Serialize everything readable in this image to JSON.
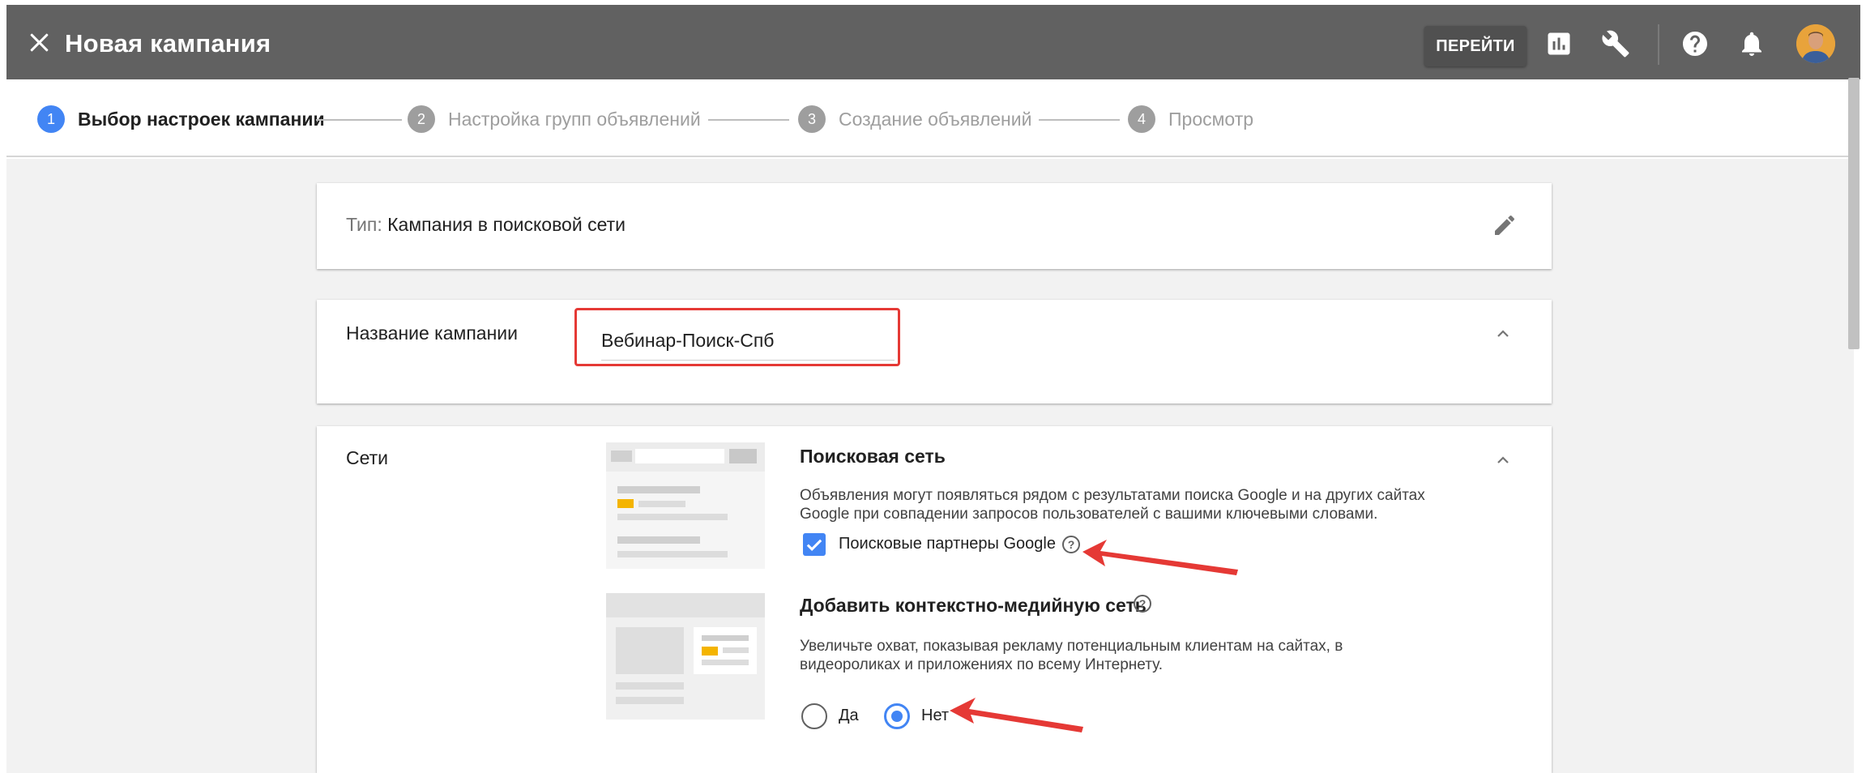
{
  "header": {
    "title": "Новая кампания",
    "goto_label": "ПЕРЕЙТИ",
    "icons": [
      "close-icon",
      "bar-chart-icon",
      "wrench-icon",
      "help-icon",
      "bell-icon",
      "avatar"
    ]
  },
  "stepper": {
    "steps": [
      {
        "num": "1",
        "label": "Выбор настроек кампании"
      },
      {
        "num": "2",
        "label": "Настройка групп объявлений"
      },
      {
        "num": "3",
        "label": "Создание объявлений"
      },
      {
        "num": "4",
        "label": "Просмотр"
      }
    ]
  },
  "type_card": {
    "prefix": "Тип:",
    "value": "Кампания в поисковой сети"
  },
  "name_card": {
    "label": "Название кампании",
    "value": "Вебинар-Поиск-Спб"
  },
  "networks_card": {
    "label": "Сети",
    "search": {
      "title": "Поисковая сеть",
      "description_line1": "Объявления могут появляться рядом с результатами поиска Google и на других сайтах",
      "description_line2": "Google при совпадении запросов пользователей с вашими ключевыми словами.",
      "partners_label": "Поисковые партнеры Google",
      "partners_checked": true
    },
    "display": {
      "title": "Добавить контекстно-медийную сеть",
      "description_line1": "Увеличьте охват, показывая рекламу потенциальным клиентам на сайтах, в",
      "description_line2": "видеороликах и приложениях по всему Интернету.",
      "option_yes": "Да",
      "option_no": "Нет",
      "selected": "Нет"
    }
  },
  "colors": {
    "topbar": "#616161",
    "accent": "#4285f4",
    "highlight": "#e53935",
    "illustration_yellow": "#f4b400"
  }
}
